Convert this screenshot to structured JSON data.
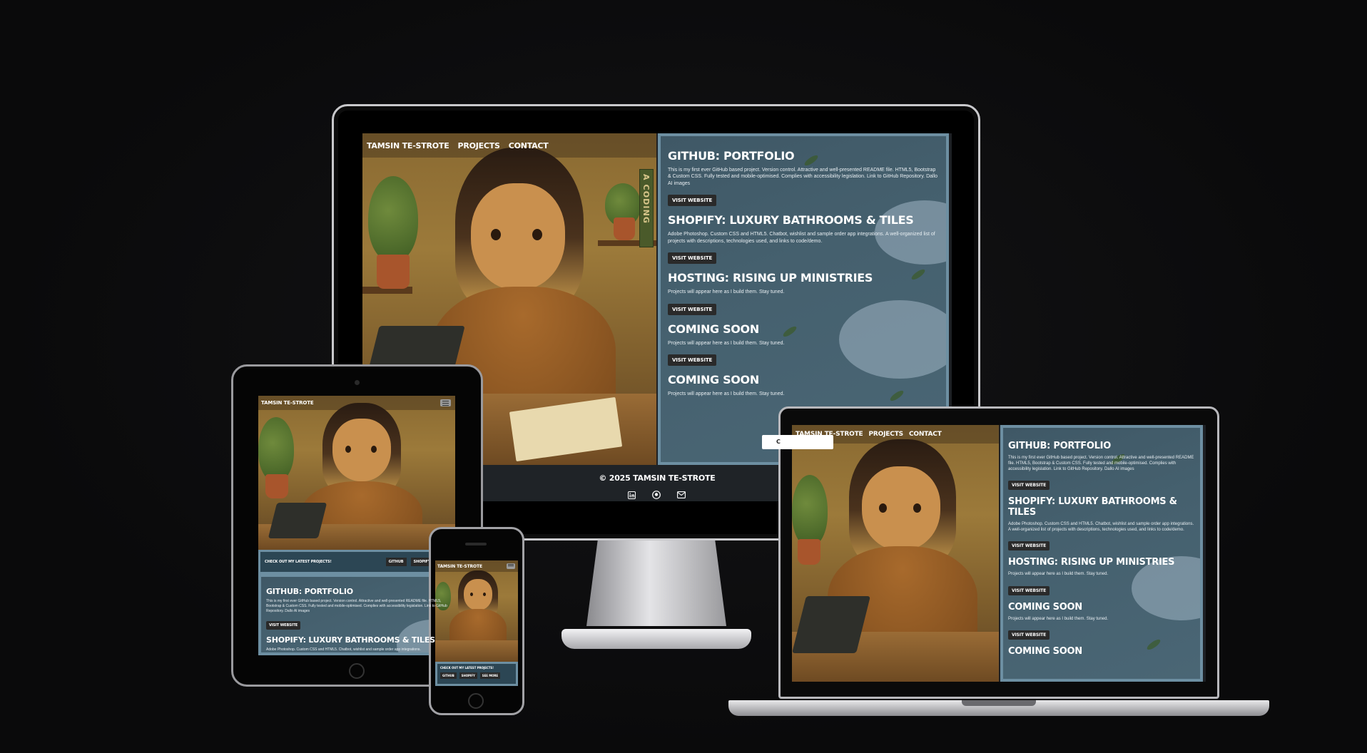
{
  "site": {
    "brand": "TAMSIN TE-STROTE",
    "nav": [
      "PROJECTS",
      "CONTACT"
    ],
    "footer_copyright": "© 2025 TAMSIN TE-STROTE",
    "strip_label": "CHECK OUT MY LATEST PROJECTS!",
    "strip_buttons_tablet": [
      "GITHUB",
      "SHOPIFY",
      "SH"
    ],
    "strip_buttons_phone": [
      "GITHUB",
      "SHOPIFY",
      "SEE MORE"
    ],
    "cta_partial": "C"
  },
  "projects": [
    {
      "title": "GITHUB: PORTFOLIO",
      "desc": "This is my first ever GitHub based project. Version control. Attractive and well-presented README file. HTML5, Bootstrap & Custom CSS. Fully tested and mobile-optimised. Complies with accessibility legislation. Link to GitHub Repository. Dallo AI images",
      "button": "VISIT WEBSITE"
    },
    {
      "title": "SHOPIFY: LUXURY BATHROOMS & TILES",
      "desc": "Adobe Photoshop. Custom CSS and HTML5. Chatbot, wishlist and sample order app integrations. A well-organized list of projects with descriptions, technologies used, and links to code/demo.",
      "button": "VISIT WEBSITE"
    },
    {
      "title": "HOSTING: RISING UP MINISTRIES",
      "desc": "Projects will appear here as I build them. Stay tuned.",
      "button": "VISIT WEBSITE"
    },
    {
      "title": "COMING SOON",
      "desc": "Projects will appear here as I build them. Stay tuned.",
      "button": "VISIT WEBSITE"
    },
    {
      "title": "COMING SOON",
      "desc": "Projects will appear here as I build them. Stay tuned.",
      "button": ""
    }
  ],
  "tablet_projects": [
    {
      "title": "GITHUB: PORTFOLIO",
      "desc": "This is my first ever GitHub based project. Version control. Attractive and well-presented README file. HTML5, Bootstrap & Custom CSS. Fully tested and mobile-optimised. Complies with accessibility legislation. Link to GitHub Repository. Dallo AI images",
      "button": "VISIT WEBSITE"
    },
    {
      "title": "SHOPIFY: LUXURY BATHROOMS & TILES",
      "desc": "Adobe Photoshop. Custom CSS and HTML5. Chatbot, wishlist and sample order app integrations.",
      "button": ""
    }
  ],
  "art": {
    "book_spine_text": "A CODING"
  },
  "colors": {
    "background": "#0b0b0c",
    "panel": "#45606e",
    "panel_border": "#6d8fa2",
    "button": "#2a2a2a",
    "footer": "#1f2327"
  },
  "icons": [
    "linkedin-icon",
    "github-icon",
    "mail-icon",
    "hamburger-menu-icon"
  ]
}
